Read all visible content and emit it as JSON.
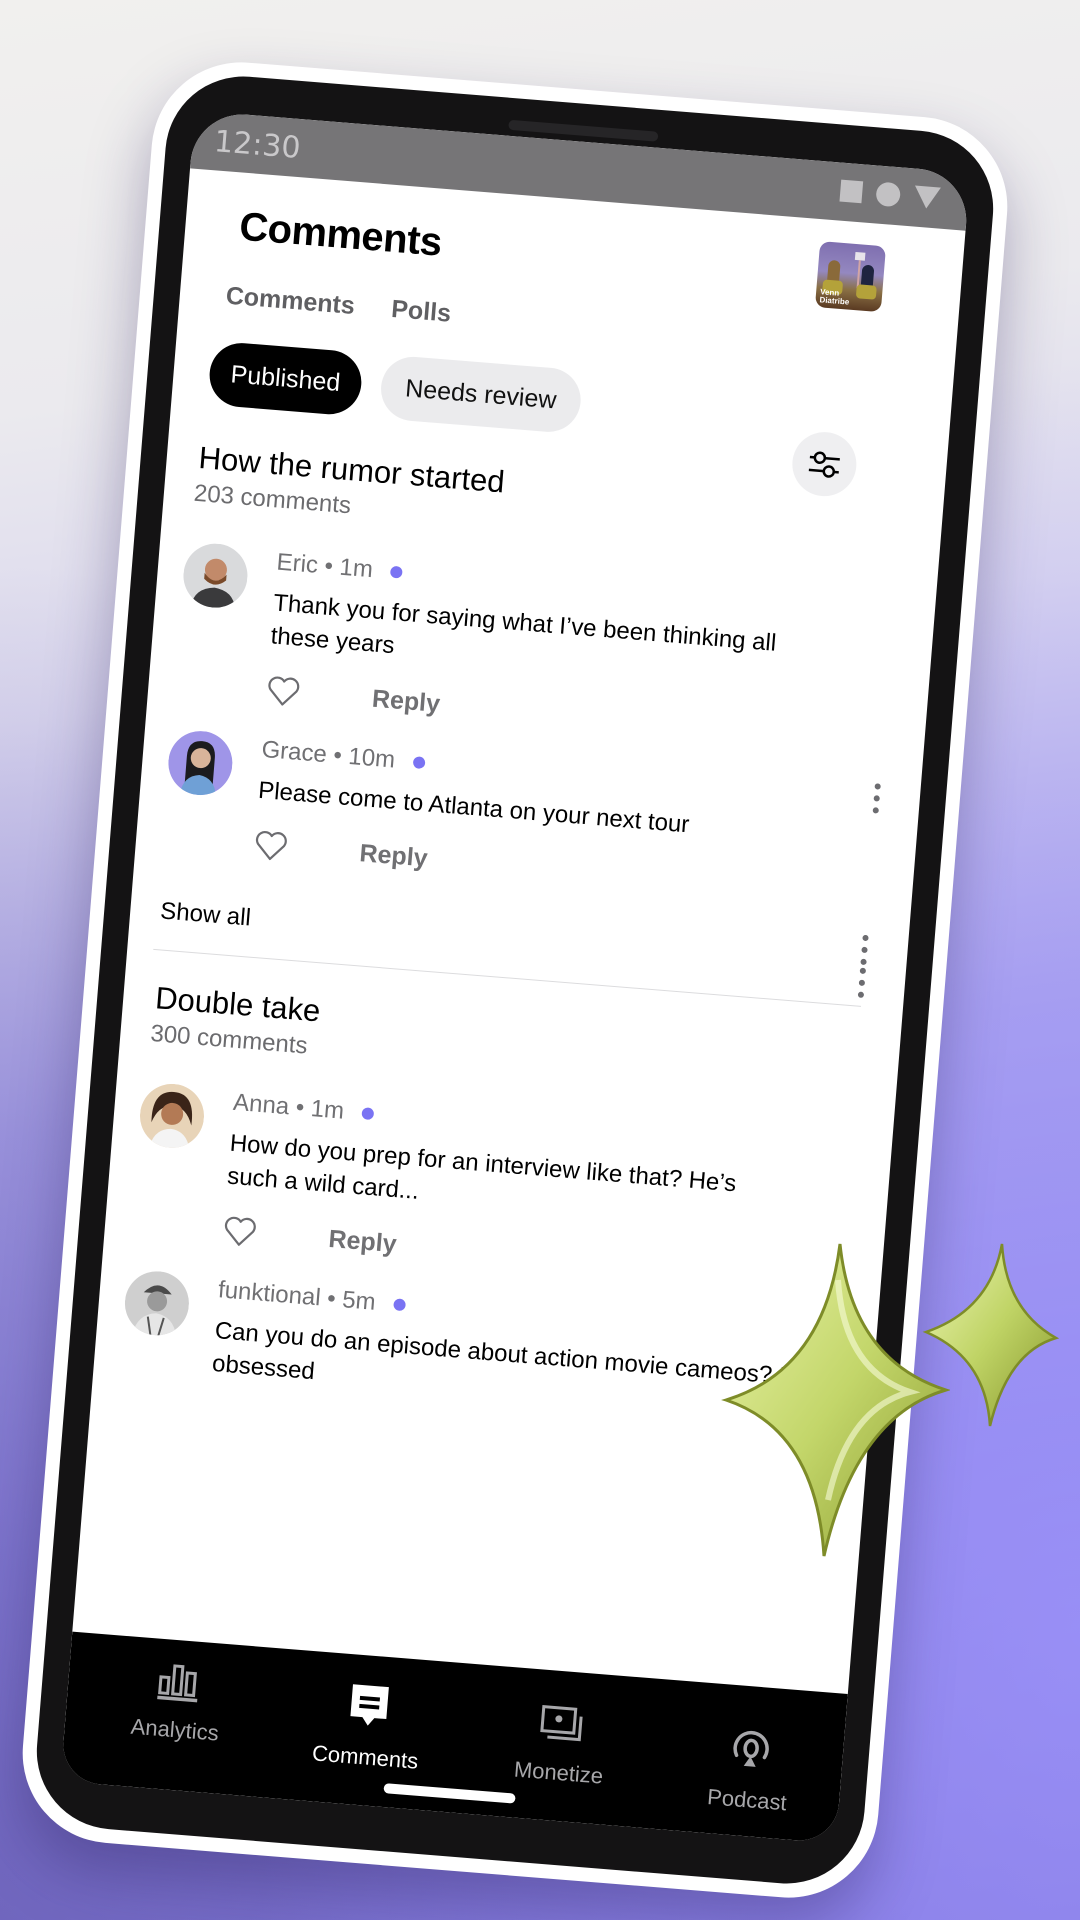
{
  "status_bar": {
    "time": "12:30",
    "icons": [
      "square-icon",
      "circle-icon",
      "triangle-icon"
    ]
  },
  "header": {
    "title": "Comments",
    "podcast_cover_text": "Venn\nDiatribe"
  },
  "tabs": [
    {
      "label": "Comments",
      "active": true
    },
    {
      "label": "Polls",
      "active": false
    }
  ],
  "filters": {
    "chips": [
      {
        "label": "Published",
        "selected": true
      },
      {
        "label": "Needs review",
        "selected": false
      }
    ],
    "filter_icon": "sliders-icon"
  },
  "episodes": [
    {
      "title": "How the rumor started",
      "count": "203 comments",
      "comments": [
        {
          "author": "Eric",
          "time": "1m",
          "text": "Thank you for saying what I’ve been thinking all these years",
          "unread": true,
          "reply_label": "Reply"
        },
        {
          "author": "Grace",
          "time": "10m",
          "text": "Please come to Atlanta on your next tour",
          "unread": true,
          "reply_label": "Reply"
        }
      ],
      "show_all_label": "Show all"
    },
    {
      "title": "Double take",
      "count": "300 comments",
      "comments": [
        {
          "author": "Anna",
          "time": "1m",
          "text": "How do you prep for an interview like that? He’s such a wild card...",
          "unread": true,
          "reply_label": "Reply"
        },
        {
          "author": "funktional",
          "time": "5m",
          "text": "Can you do an episode about action movie cameos? I’m obsessed",
          "unread": true,
          "reply_label": ""
        }
      ]
    }
  ],
  "meta_separator": " • ",
  "bottom_nav": [
    {
      "label": "Analytics",
      "icon": "bar-chart-icon",
      "active": false
    },
    {
      "label": "Comments",
      "icon": "comment-bubble-icon",
      "active": true
    },
    {
      "label": "Monetize",
      "icon": "media-stack-icon",
      "active": false
    },
    {
      "label": "Podcast",
      "icon": "podcast-mic-icon",
      "active": false
    }
  ],
  "colors": {
    "unread_dot": "#7a73f3",
    "accent_background": "#9a90f2",
    "selected_chip": "#000000",
    "unselected_chip": "#ebebed"
  }
}
